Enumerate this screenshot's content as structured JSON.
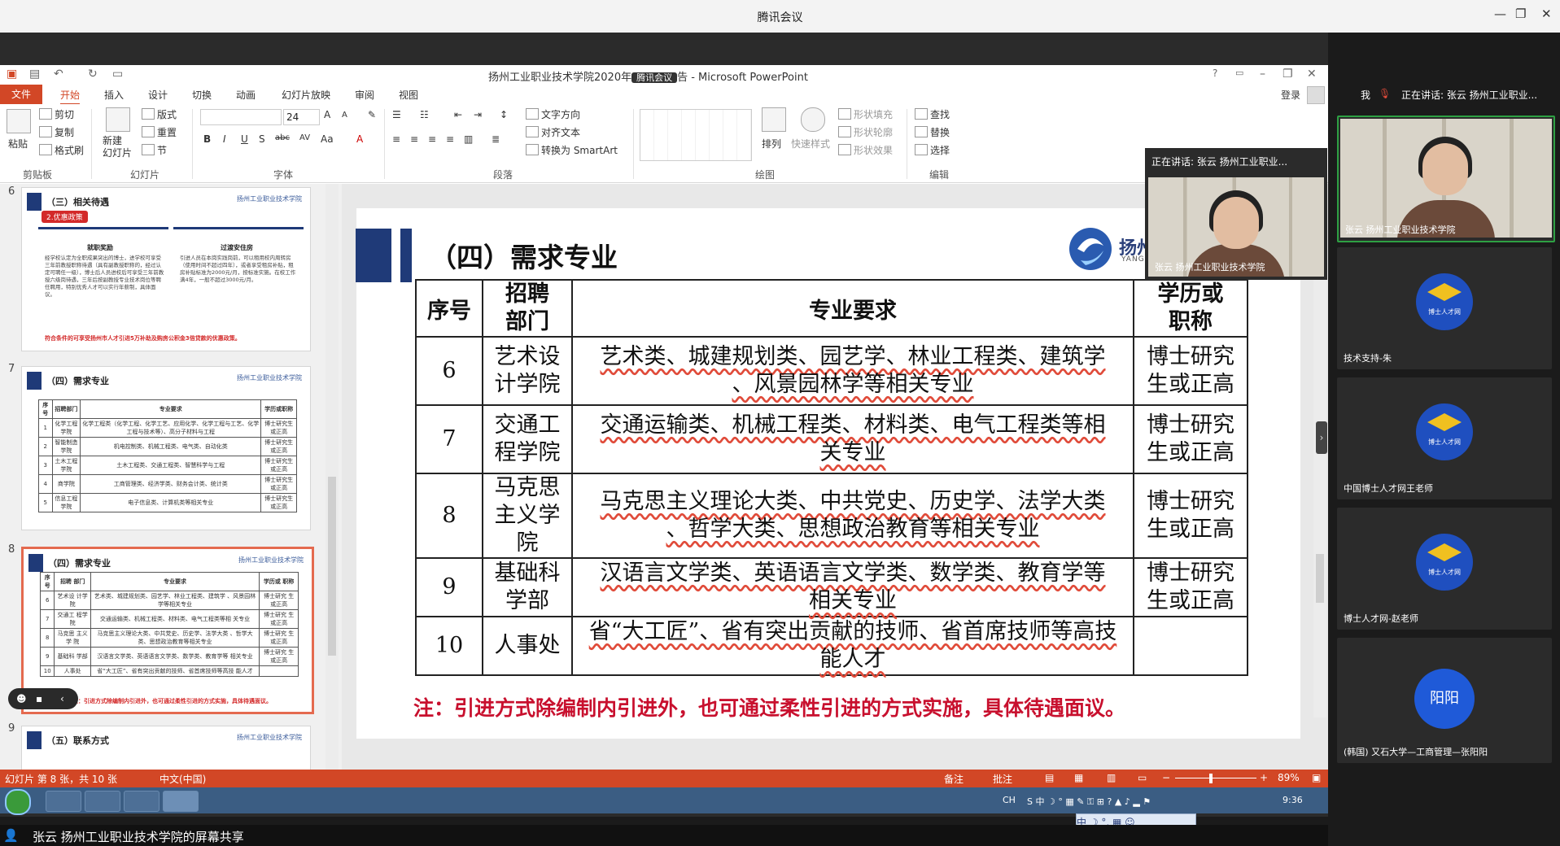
{
  "tencent": {
    "title": "腾讯会议",
    "win_min": "—",
    "win_restore": "❐",
    "win_close": "✕"
  },
  "ppt": {
    "title": "扬州工业职业技术学院2020年",
    "title_overlay": "腾讯会议",
    "title_suffix": "告 - Microsoft PowerPoint",
    "login": "登录",
    "help": "?",
    "tabs": [
      "文件",
      "开始",
      "插入",
      "设计",
      "切换",
      "动画",
      "幻灯片放映",
      "审阅",
      "视图"
    ],
    "ribbon": {
      "paste": "粘贴",
      "cut": "剪切",
      "copy": "复制",
      "format_painter": "格式刷",
      "clipboard": "剪贴板",
      "new_slide": "新建\n幻灯片",
      "layout": "版式",
      "reset": "重置",
      "section": "节",
      "slides_group": "幻灯片",
      "font_size": "24",
      "font_group": "字体",
      "text_direction": "文字方向",
      "align_text": "对齐文本",
      "convert_smartart": "转换为 SmartArt",
      "paragraph_group": "段落",
      "arrange": "排列",
      "quick_styles": "快速样式",
      "shape_fill": "形状填充",
      "shape_outline": "形状轮廓",
      "shape_effects": "形状效果",
      "drawing_group": "绘图",
      "find": "查找",
      "replace": "替换",
      "select": "选择",
      "editing_group": "编辑"
    }
  },
  "thumbs": {
    "n6": "6",
    "n7": "7",
    "n8": "8",
    "n9": "9",
    "t6_title": "（三）相关待遇",
    "t6_badge": "2.优惠政策",
    "t6_col1": "就职奖励",
    "t6_col2": "过渡安住房",
    "t6_body1": "经学校认定为全职成果突出的博士，进学校可享受三年前教授职称待遇（具有副教授职称的，经过认定可聘任一级），博士后人员进校后可享受三年前教授六级岗待遇，三年后按副教授专业技术岗位等聘任聘用，特别优秀人才可以实行年薪制，具体面议。",
    "t6_body2": "引进人员在本岗实践岗前，可以租用校内周转房（使用时间不超过四年），或者享受租房补贴，租房补贴标准为2000元/月，按标准实施。在校工作满4年，一般不超过3000元/月。",
    "t6_note": "符合条件的可享受扬州市人才引进5万补助及购房公积金3倍贷款的优惠政策。",
    "t7_title": "（四）需求专业",
    "t7_rows": [
      [
        "序号",
        "招聘部门",
        "专业要求",
        "学历或职称"
      ],
      [
        "1",
        "化学工程学院",
        "化学工程类（化学工程、化学工艺、应用化学、化学工程与工艺、化学工程与技术等）、高分子材料与工程",
        "博士研究生或正高"
      ],
      [
        "2",
        "智能制造学院",
        "机电控制类、机械工程类、电气类、自动化类",
        "博士研究生或正高"
      ],
      [
        "3",
        "土木工程学院",
        "土木工程类、交通工程类、智慧科学与工程",
        "博士研究生或正高"
      ],
      [
        "4",
        "商学院",
        "工商管理类、经济学类、财务会计类、统计类",
        "博士研究生或正高"
      ],
      [
        "5",
        "信息工程学院",
        "电子信息类、计算机类等相关专业",
        "博士研究生或正高"
      ]
    ],
    "t8_title": "（四）需求专业",
    "t8_note": "注：引进方式除编制内引进外，也可通过柔性引进的方式实施，具体待遇面议。",
    "t9_title": "（五）联系方式",
    "logo_small": "扬州工业职业技术学院"
  },
  "slide": {
    "title": "（四）需求专业",
    "logo_text": "扬州",
    "logo_sub": "YANGZ",
    "headers": {
      "num": "序号",
      "dept": "招聘\n部门",
      "major": "专业要求",
      "degree": "学历或\n职称"
    },
    "rows": [
      {
        "num": "6",
        "dept": "艺术设\n计学院",
        "major": "艺术类、城建规划类、园艺学、林业工程类、建筑学\n、风景园林学等相关专业",
        "degree": "博士研究\n生或正高"
      },
      {
        "num": "7",
        "dept": "交通工\n程学院",
        "major": "交通运输类、机械工程类、材料类、电气工程类等相\n关专业",
        "degree": "博士研究\n生或正高"
      },
      {
        "num": "8",
        "dept": "马克思\n主义学\n院",
        "major": "马克思主义理论大类、中共党史、历史学、法学大类\n、哲学大类、思想政治教育等相关专业",
        "degree": "博士研究\n生或正高"
      },
      {
        "num": "9",
        "dept": "基础科\n学部",
        "major": "汉语言文学类、英语语言文学类、数学类、教育学等\n相关专业",
        "degree": "博士研究\n生或正高"
      },
      {
        "num": "10",
        "dept": "人事处",
        "major": "省“大工匠”、省有突出贡献的技师、省首席技师等高技\n能人才",
        "degree": ""
      }
    ],
    "note": "注：引进方式除编制内引进外，也可通过柔性引进的方式实施，具体待遇面议。"
  },
  "status": {
    "slide_info": "幻灯片 第 8 张，共 10 张",
    "language": "中文(中国)",
    "notes": "备注",
    "comments": "批注",
    "zoom": "89%",
    "minus": "−",
    "plus": "+"
  },
  "taskbar": {
    "clock": "9:36",
    "tray": "CH"
  },
  "ime": {
    "text": "中 ☽ °, ▦ ☺"
  },
  "sharebar": {
    "text": "张云 扬州工业职业技术学院的屏幕共享"
  },
  "float_video": {
    "header": "正在讲话: 张云 扬州工业职业...",
    "label": "张云 扬州工业职业技术学院"
  },
  "rpanel": {
    "me": "我",
    "speaking": "正在讲话: 张云 扬州工业职业...",
    "tiles": [
      {
        "label": "张云 扬州工业职业技术学院"
      },
      {
        "label": "技术支持-朱"
      },
      {
        "label": "中国博士人才网王老师"
      },
      {
        "label": "博士人才网-赵老师"
      },
      {
        "label": "(韩国) 又石大学—工商管理—张阳阳"
      }
    ],
    "avatar_caption": "博士人才网",
    "yy_avatar": "阳阳",
    "edge": "›"
  }
}
